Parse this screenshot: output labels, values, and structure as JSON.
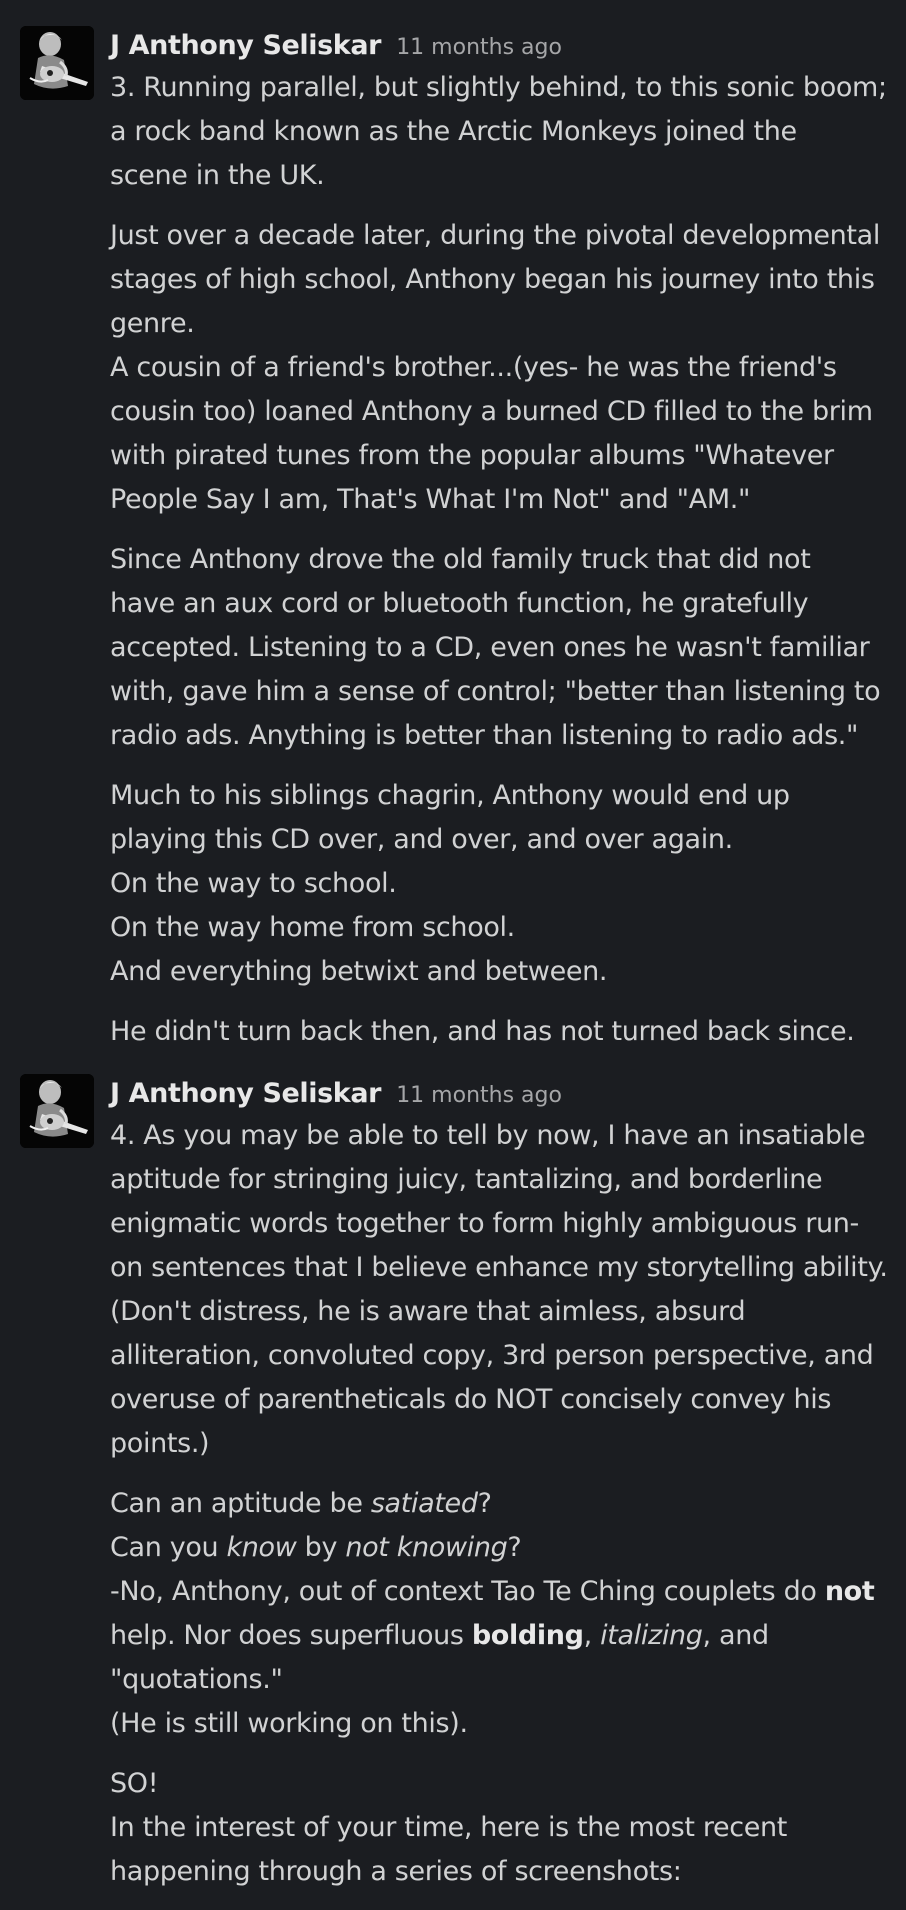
{
  "messages": [
    {
      "author": "J Anthony Seliskar",
      "time": "11 months ago",
      "paragraphs": [
        [
          "3. Running parallel, but slightly behind, to this sonic boom;",
          "a rock band known as the Arctic Monkeys joined the",
          "scene in the UK."
        ],
        [
          "Just over a decade later, during the pivotal developmental",
          "stages of high school, Anthony began his journey into this",
          "genre.",
          "A cousin of a friend's brother...(yes- he was the friend's",
          "cousin too) loaned Anthony a burned CD filled to the brim",
          "with pirated tunes from the popular albums \"Whatever",
          "People Say I am, That's What I'm Not\" and \"AM.\""
        ],
        [
          "Since Anthony drove the old family truck that did not",
          "have an aux cord or bluetooth function, he gratefully",
          "accepted. Listening to a CD, even ones he wasn't familiar",
          "with, gave him a sense of control; \"better than listening to",
          "radio ads. Anything is better than listening to radio ads.\""
        ],
        [
          "Much to his siblings chagrin, Anthony would end up",
          "playing this CD over, and over, and over again.",
          "On the way to school.",
          "On the way home from school.",
          "And everything betwixt and between."
        ],
        [
          "He didn't turn back then, and has not turned back since."
        ]
      ]
    },
    {
      "author": "J Anthony Seliskar",
      "time": "11 months ago",
      "paragraphs": [
        [
          "4. As you may be able to tell by now, I have an insatiable",
          "aptitude for stringing juicy, tantalizing, and borderline",
          "enigmatic words together to form highly ambiguous run-",
          "on sentences that I believe enhance my storytelling ability.",
          "(Don't distress, he is aware that aimless, absurd",
          "alliteration, convoluted copy, 3rd person perspective, and",
          "overuse of parentheticals do NOT concisely convey his",
          "points.)"
        ],
        [
          "Can an aptitude be ",
          "satiated",
          "?",
          "Can you ",
          "know",
          " by ",
          "not knowing",
          "?",
          "-No, Anthony, out of context Tao Te Ching couplets do ",
          "not",
          "help. Nor does superfluous ",
          "bolding",
          ", ",
          "italizing",
          ", and",
          "\"quotations.\"",
          "(He is still working on this)."
        ],
        [
          "SO!",
          "In the interest of your time, here is the most recent",
          "happening through a series of screenshots:"
        ]
      ]
    }
  ]
}
